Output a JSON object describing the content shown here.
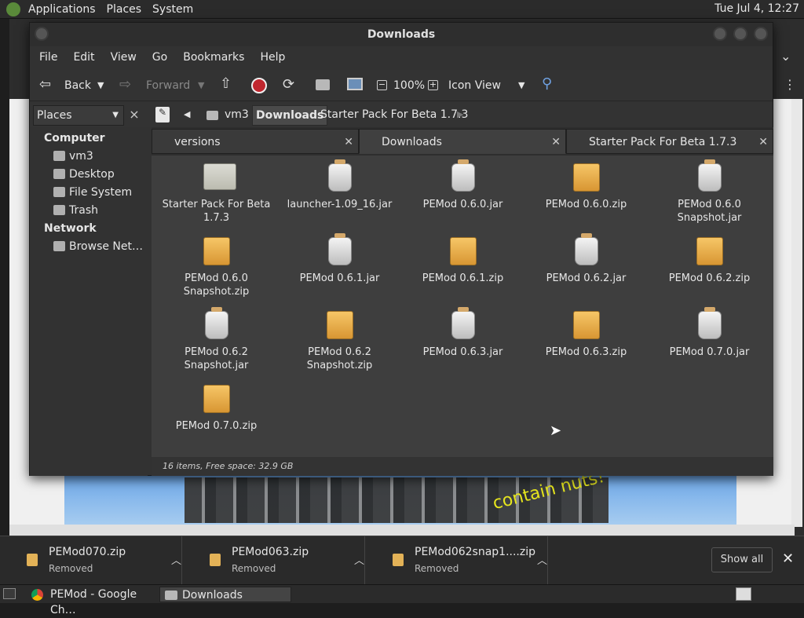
{
  "top_panel": {
    "menus": [
      "Applications",
      "Places",
      "System"
    ],
    "clock": "Tue Jul  4, 12:27"
  },
  "file_manager": {
    "title": "Downloads",
    "menubar": [
      "File",
      "Edit",
      "View",
      "Go",
      "Bookmarks",
      "Help"
    ],
    "toolbar": {
      "back_label": "Back",
      "forward_label": "Forward",
      "zoom": "100%",
      "view_mode": "Icon View"
    },
    "places_select": "Places",
    "breadcrumbs": [
      "vm3",
      "Downloads",
      "Starter Pack For Beta 1.7.3"
    ],
    "sidebar": {
      "computer_heading": "Computer",
      "computer_items": [
        "vm3",
        "Desktop",
        "File System",
        "Trash"
      ],
      "network_heading": "Network",
      "network_items": [
        "Browse Net…"
      ]
    },
    "tabs": [
      {
        "label": "versions",
        "active": false
      },
      {
        "label": "Downloads",
        "active": true
      },
      {
        "label": "Starter Pack For Beta 1.7.3",
        "active": false
      }
    ],
    "files": [
      {
        "name": "Starter Pack For Beta 1.7.3",
        "icon": "folder-icon"
      },
      {
        "name": "launcher-1.09_16.jar",
        "icon": "jar-icon"
      },
      {
        "name": "PEMod 0.6.0.jar",
        "icon": "jar-icon"
      },
      {
        "name": "PEMod 0.6.0.zip",
        "icon": "zip-icon"
      },
      {
        "name": "PEMod 0.6.0 Snapshot.jar",
        "icon": "jar-icon"
      },
      {
        "name": "PEMod 0.6.0 Snapshot.zip",
        "icon": "zip-icon"
      },
      {
        "name": "PEMod 0.6.1.jar",
        "icon": "jar-icon"
      },
      {
        "name": "PEMod 0.6.1.zip",
        "icon": "zip-icon"
      },
      {
        "name": "PEMod 0.6.2.jar",
        "icon": "jar-icon"
      },
      {
        "name": "PEMod 0.6.2.zip",
        "icon": "zip-icon"
      },
      {
        "name": "PEMod 0.6.2 Snapshot.jar",
        "icon": "jar-icon"
      },
      {
        "name": "PEMod 0.6.2 Snapshot.zip",
        "icon": "zip-icon"
      },
      {
        "name": "PEMod 0.6.3.jar",
        "icon": "jar-icon"
      },
      {
        "name": "PEMod 0.6.3.zip",
        "icon": "zip-icon"
      },
      {
        "name": "PEMod 0.7.0.jar",
        "icon": "jar-icon"
      },
      {
        "name": "PEMod 0.7.0.zip",
        "icon": "zip-icon"
      }
    ],
    "status": "16 items, Free space: 32.9 GB"
  },
  "download_shelf": {
    "items": [
      {
        "name": "PEMod070.zip",
        "status": "Removed"
      },
      {
        "name": "PEMod063.zip",
        "status": "Removed"
      },
      {
        "name": "PEMod062snap1....zip",
        "status": "Removed"
      }
    ],
    "show_all": "Show all"
  },
  "background_page": {
    "splash_text": "contain nuts!"
  },
  "taskbar": {
    "tasks": [
      "PEMod - Google Ch…",
      "Downloads"
    ]
  }
}
